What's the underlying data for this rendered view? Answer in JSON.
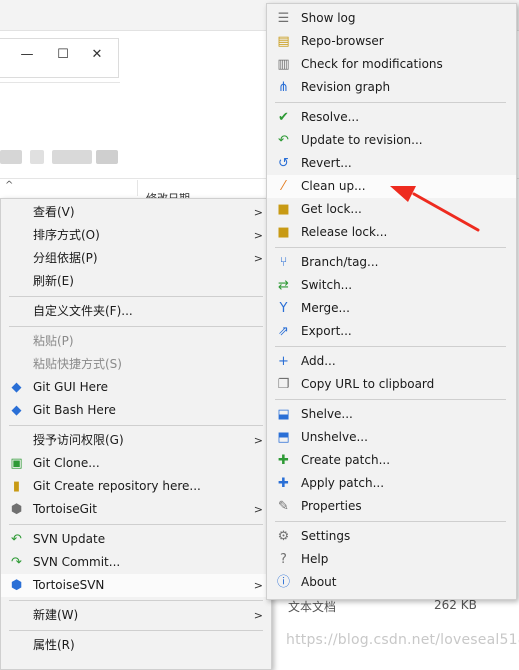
{
  "background": {
    "window_controls": {
      "minimize": "—",
      "maximize": "☐",
      "close": "✕"
    },
    "column_header": "修改日期",
    "file_type": "文本文档",
    "file_size": "262 KB",
    "watermark": "https://blog.csdn.net/loveseal518"
  },
  "context_menu": {
    "items": [
      {
        "label": "查看(V)",
        "icon": "",
        "submenu": true
      },
      {
        "label": "排序方式(O)",
        "icon": "",
        "submenu": true
      },
      {
        "label": "分组依据(P)",
        "icon": "",
        "submenu": true
      },
      {
        "label": "刷新(E)",
        "icon": ""
      },
      {
        "label": "自定义文件夹(F)...",
        "icon": ""
      },
      {
        "label": "粘贴(P)",
        "icon": "",
        "disabled": true
      },
      {
        "label": "粘贴快捷方式(S)",
        "icon": "",
        "disabled": true
      },
      {
        "label": "Git GUI Here",
        "icon": "git-gui-icon"
      },
      {
        "label": "Git Bash Here",
        "icon": "git-bash-icon"
      },
      {
        "label": "授予访问权限(G)",
        "icon": "",
        "submenu": true
      },
      {
        "label": "Git Clone...",
        "icon": "git-clone-icon"
      },
      {
        "label": "Git Create repository here...",
        "icon": "git-create-repo-icon"
      },
      {
        "label": "TortoiseGit",
        "icon": "tortoisegit-icon",
        "submenu": true
      },
      {
        "label": "SVN Update",
        "icon": "svn-update-icon"
      },
      {
        "label": "SVN Commit...",
        "icon": "svn-commit-icon"
      },
      {
        "label": "TortoiseSVN",
        "icon": "tortoisesvn-icon",
        "submenu": true
      },
      {
        "label": "新建(W)",
        "icon": "",
        "submenu": true
      },
      {
        "label": "属性(R)",
        "icon": ""
      }
    ]
  },
  "tortoisesvn_submenu": {
    "items": [
      {
        "label": "Show log",
        "icon": "show-log-icon"
      },
      {
        "label": "Repo-browser",
        "icon": "repo-browser-icon"
      },
      {
        "label": "Check for modifications",
        "icon": "check-modifications-icon"
      },
      {
        "label": "Revision graph",
        "icon": "revision-graph-icon"
      },
      {
        "label": "Resolve...",
        "icon": "resolve-icon"
      },
      {
        "label": "Update to revision...",
        "icon": "update-to-revision-icon"
      },
      {
        "label": "Revert...",
        "icon": "revert-icon"
      },
      {
        "label": "Clean up...",
        "icon": "clean-up-icon",
        "highlighted": true
      },
      {
        "label": "Get lock...",
        "icon": "get-lock-icon"
      },
      {
        "label": "Release lock...",
        "icon": "release-lock-icon"
      },
      {
        "label": "Branch/tag...",
        "icon": "branch-tag-icon"
      },
      {
        "label": "Switch...",
        "icon": "switch-icon"
      },
      {
        "label": "Merge...",
        "icon": "merge-icon"
      },
      {
        "label": "Export...",
        "icon": "export-icon"
      },
      {
        "label": "Add...",
        "icon": "add-icon"
      },
      {
        "label": "Copy URL to clipboard",
        "icon": "copy-url-icon"
      },
      {
        "label": "Shelve...",
        "icon": "shelve-icon"
      },
      {
        "label": "Unshelve...",
        "icon": "unshelve-icon"
      },
      {
        "label": "Create patch...",
        "icon": "create-patch-icon"
      },
      {
        "label": "Apply patch...",
        "icon": "apply-patch-icon"
      },
      {
        "label": "Properties",
        "icon": "properties-icon"
      },
      {
        "label": "Settings",
        "icon": "settings-icon"
      },
      {
        "label": "Help",
        "icon": "help-icon"
      },
      {
        "label": "About",
        "icon": "about-icon"
      }
    ]
  },
  "colors": {
    "menu_bg": "#f2f2f2",
    "highlight_bg": "#fbfbfb",
    "annotation_arrow": "#ee2b1f"
  }
}
